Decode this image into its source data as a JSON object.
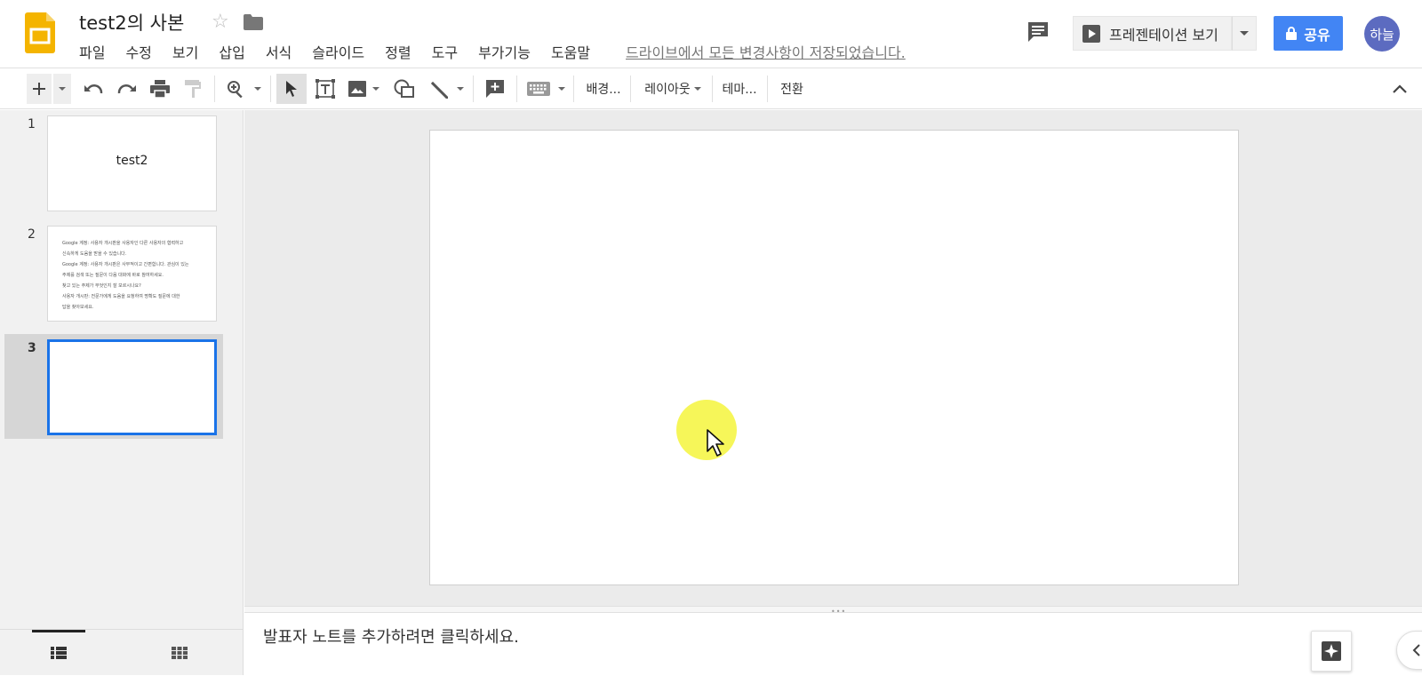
{
  "header": {
    "title": "test2의 사본",
    "menus": [
      "파일",
      "수정",
      "보기",
      "삽입",
      "서식",
      "슬라이드",
      "정렬",
      "도구",
      "부가기능",
      "도움말"
    ],
    "save_status": "드라이브에서 모든 변경사항이 저장되었습니다.",
    "present_label": "프레젠테이션 보기",
    "share_label": "공유",
    "avatar_text": "하늘"
  },
  "toolbar": {
    "background": "배경...",
    "layout": "레이아웃",
    "theme": "테마...",
    "transition": "전환"
  },
  "slides": [
    {
      "number": "1",
      "title": "test2"
    },
    {
      "number": "2",
      "lines": [
        "Google 계정: 사용자 개시판을 사용자인 다른 사용자의 협력하고",
        "신속하게 도움을 받을 수 있습니다.",
        "Google 계정: 사용자 개시판은 사무적이고 간편합니다. 관심이 있는",
        "주제를 검색 또는 질문이 다음 대화에 바로 참여하세요.",
        "찾고 있는 주제가 무엇인지 잘 모르시나요?",
        "사용자 개시판: 전문가에게 도움을 요청하여 명확도 질문에 대한",
        "답을 찾아보세요."
      ]
    },
    {
      "number": "3"
    }
  ],
  "notes_placeholder": "발표자 노트를 추가하려면 클릭하세요.",
  "colors": {
    "share_button": "#4285f4",
    "selected_slide_border": "#1a73e8",
    "avatar": "#5c6bc0",
    "logo": "#f4b400"
  }
}
